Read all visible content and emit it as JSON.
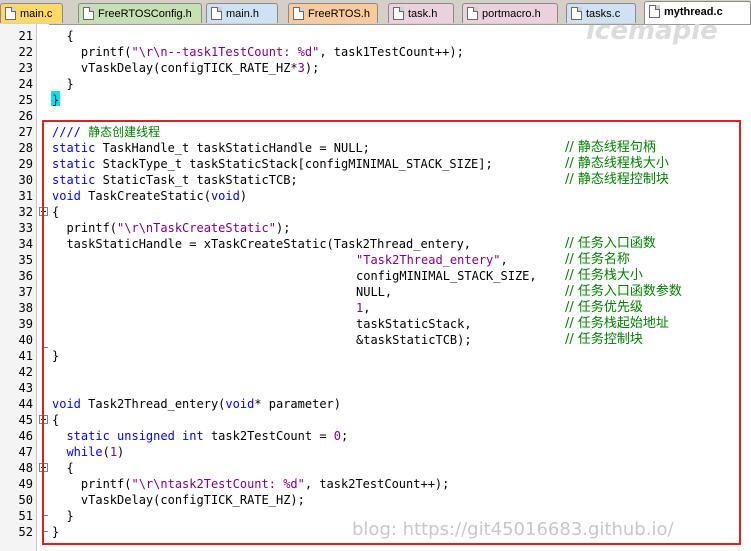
{
  "tabs": [
    {
      "label": "main.c",
      "color": "#ffd966",
      "active": false
    },
    {
      "label": "FreeRTOSConfig.h",
      "color": "#c5e0b3",
      "active": false
    },
    {
      "label": "main.h",
      "color": "#cfe2f3",
      "active": false
    },
    {
      "label": "FreeRTOS.h",
      "color": "#f9cb9c",
      "active": false
    },
    {
      "label": "task.h",
      "color": "#ead1dc",
      "active": false
    },
    {
      "label": "portmacro.h",
      "color": "#ead1dc",
      "active": false
    },
    {
      "label": "tasks.c",
      "color": "#cfe2f3",
      "active": false
    },
    {
      "label": "mythread.c",
      "color": "#ffffff",
      "active": true
    }
  ],
  "line_numbers": [
    "21",
    "22",
    "23",
    "24",
    "25",
    "26",
    "27",
    "28",
    "29",
    "30",
    "31",
    "32",
    "33",
    "34",
    "35",
    "36",
    "37",
    "38",
    "39",
    "40",
    "41",
    "42",
    "43",
    "44",
    "45",
    "46",
    "47",
    "48",
    "49",
    "50",
    "51",
    "52"
  ],
  "code": {
    "l21": "{",
    "l22_a": "printf(",
    "l22_s": "\"\\r\\n--task1TestCount: %d\"",
    "l22_b": ", task1TestCount++);",
    "l23_a": "vTaskDelay(configTICK_RATE_HZ*",
    "l23_n": "3",
    "l23_b": ");",
    "l24": "}",
    "l25": "}",
    "l27_slash": "////",
    "l27_cm": "静态创建线程",
    "l28_kw": "static",
    "l28_rest": " TaskHandle_t taskStaticHandle = NULL;",
    "l28_cm": "// 静态线程句柄",
    "l29_kw": "static",
    "l29_rest": " StackType_t taskStaticStack[configMINIMAL_STACK_SIZE];",
    "l29_cm": "// 静态线程栈大小",
    "l30_kw": "static",
    "l30_rest": " StaticTask_t taskStaticTCB;",
    "l30_cm": "// 静态线程控制块",
    "l31_kw": "void",
    "l31_rest": " TaskCreateStatic(",
    "l31_kw2": "void",
    "l31_end": ")",
    "l32": "{",
    "l33_a": "printf(",
    "l33_s": "\"\\r\\nTaskCreateStatic\"",
    "l33_b": ");",
    "l34": "taskStaticHandle = xTaskCreateStatic(Task2Thread_entery,",
    "l34_cm": "// 任务入口函数",
    "l35_s": "\"Task2Thread_entery\"",
    "l35_b": ",",
    "l35_cm": "// 任务名称",
    "l36": "configMINIMAL_STACK_SIZE,",
    "l36_cm": "// 任务栈大小",
    "l37": "NULL,",
    "l37_cm": "// 任务入口函数参数",
    "l38_n": "1",
    "l38_b": ",",
    "l38_cm": "// 任务优先级",
    "l39": "taskStaticStack,",
    "l39_cm": "// 任务栈起始地址",
    "l40": "&taskStaticTCB);",
    "l40_cm": "// 任务控制块",
    "l41": "}",
    "l44_kw": "void",
    "l44_rest": " Task2Thread_entery(",
    "l44_kw2": "void",
    "l44_end": "* parameter)",
    "l45": "{",
    "l46_kw": "static unsigned int",
    "l46_rest": " task2TestCount = ",
    "l46_n": "0",
    "l46_end": ";",
    "l47_kw": "while",
    "l47_a": "(",
    "l47_n": "1",
    "l47_b": ")",
    "l48": "{",
    "l49_a": "printf(",
    "l49_s": "\"\\r\\ntask2TestCount: %d\"",
    "l49_b": ", task2TestCount++);",
    "l50": "vTaskDelay(configTICK_RATE_HZ);",
    "l51": "}",
    "l52": "}"
  },
  "watermark_top": "icemaple",
  "watermark_bottom": "blog: https://git45016683.github.io/"
}
